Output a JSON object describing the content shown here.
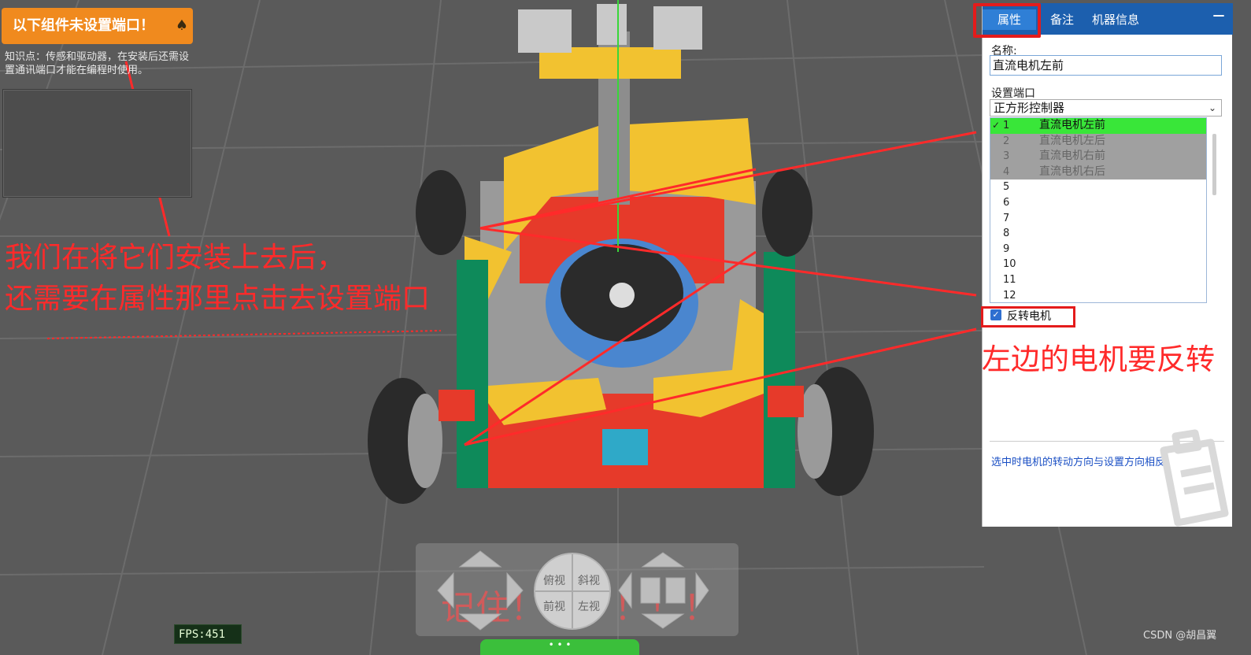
{
  "warning": {
    "title": "以下组件未设置端口！",
    "description": "知识点：传感和驱动器，在安装后还需设置通讯端口才能在编程时使用。"
  },
  "annotations": {
    "left_line1": "我们在将它们安装上去后，",
    "left_line2": "还需要在属性那里点击去设置端口",
    "right": "左边的电机要反转",
    "remember": "记住！！！！！！"
  },
  "panel": {
    "tabs": [
      {
        "label": "属性"
      },
      {
        "label": "备注"
      },
      {
        "label": "机器信息"
      }
    ],
    "minimize_glyph": "—",
    "name_label": "名称:",
    "name_value": "直流电机左前",
    "port_label": "设置端口",
    "port_selected": "正方形控制器",
    "ports": [
      {
        "num": "1",
        "label": "直流电机左前",
        "state": "selected",
        "check": "✓"
      },
      {
        "num": "2",
        "label": "直流电机左后",
        "state": "used",
        "check": ""
      },
      {
        "num": "3",
        "label": "直流电机右前",
        "state": "used",
        "check": ""
      },
      {
        "num": "4",
        "label": "直流电机右后",
        "state": "used",
        "check": ""
      },
      {
        "num": "5",
        "label": "",
        "state": "free",
        "check": ""
      },
      {
        "num": "6",
        "label": "",
        "state": "free",
        "check": ""
      },
      {
        "num": "7",
        "label": "",
        "state": "free",
        "check": ""
      },
      {
        "num": "8",
        "label": "",
        "state": "free",
        "check": ""
      },
      {
        "num": "9",
        "label": "",
        "state": "free",
        "check": ""
      },
      {
        "num": "10",
        "label": "",
        "state": "free",
        "check": ""
      },
      {
        "num": "11",
        "label": "",
        "state": "free",
        "check": ""
      },
      {
        "num": "12",
        "label": "",
        "state": "free",
        "check": ""
      }
    ],
    "reverse_label": "反转电机",
    "reverse_checked": true,
    "reverse_hint": "选中时电机的转动方向与设置方向相反"
  },
  "view_buttons": {
    "top": "俯视",
    "oblique": "斜视",
    "front": "前视",
    "left": "左视"
  },
  "fps": "FPS:451",
  "watermark": "CSDN @胡昌翼",
  "colors": {
    "warning_orange": "#f08a1e",
    "tab_blue": "#1c5fae",
    "highlight_red": "#e41b1b",
    "port_selected_green": "#39e639",
    "annotation_red": "#ff2a2a"
  }
}
